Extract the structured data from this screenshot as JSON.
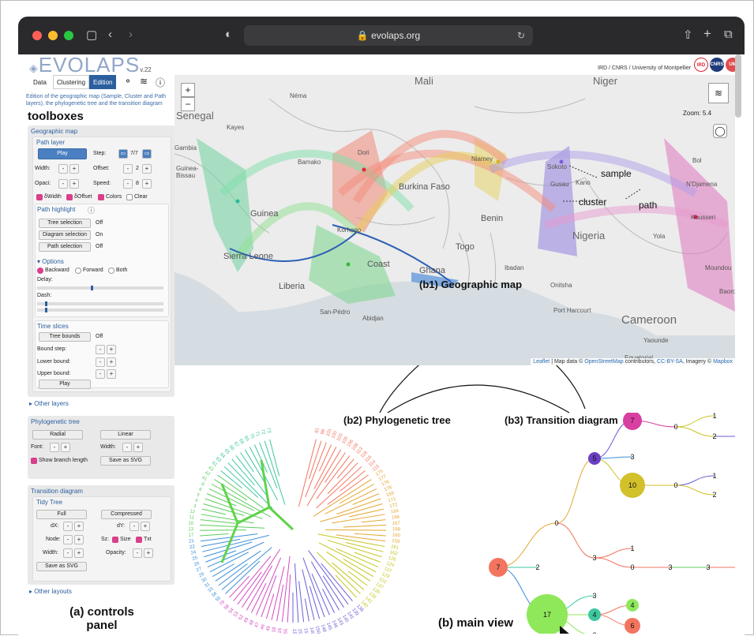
{
  "browser": {
    "url": "evolaps.org"
  },
  "header": {
    "logo": "EVOLAPS",
    "version": "v.22",
    "credit": "IRD / CNRS / University of Montpellier",
    "badges": [
      "IRD",
      "CNRS",
      "UM"
    ]
  },
  "tabs": [
    {
      "label": "Data"
    },
    {
      "label": "Clustering"
    },
    {
      "label": "Edition"
    }
  ],
  "description": "Edition of the geographic map (Sample, Cluster and Path layers), the phylogenetic tree and the transition diagram",
  "callouts": {
    "toolboxes": "toolboxes",
    "controls_panel_line1": "(a) controls",
    "controls_panel_line2": "panel",
    "main_view": "(b) main view",
    "b1": "(b1) Geographic map",
    "b2": "(b2) Phylogenetic tree",
    "b3": "(b3) Transition diagram",
    "sample": "sample",
    "cluster": "cluster",
    "path": "path"
  },
  "geomap": {
    "title": "Geographic map",
    "path_layer": {
      "title": "Path layer",
      "play": "Play",
      "step_label": "Step:",
      "step_value": "7/7",
      "width_label": "Width:",
      "offset_label": "Offset:",
      "offset_value": "2",
      "opaci_label": "Opaci:",
      "speed_label": "Speed:",
      "speed_value": "8",
      "checks": [
        "δWidth",
        "δOffset",
        "Colors",
        "Clear"
      ]
    },
    "highlight": {
      "title": "Path highlight",
      "rows": [
        {
          "button": "Tree selection",
          "state": "Off"
        },
        {
          "button": "Diagram selection",
          "state": "On"
        },
        {
          "button": "Path selection",
          "state": "Off"
        }
      ],
      "options": "Options",
      "radios": [
        "Backward",
        "Forward",
        "Both"
      ],
      "delay": "Delay:",
      "dash": "Dash:"
    },
    "time_slices": {
      "title": "Time slices",
      "tree_bounds": "Tree bounds",
      "tree_bounds_state": "Off",
      "bound_step": "Bound step:",
      "lower": "Lower bound:",
      "upper": "Upper bound:",
      "play": "Play"
    },
    "other_layers": "Other layers"
  },
  "phylo": {
    "title": "Phylogenetic tree",
    "radial": "Radial",
    "linear": "Linear",
    "font": "Font:",
    "width": "Width:",
    "show_branch": "Show branch length",
    "save": "Save as SVG"
  },
  "transition": {
    "title": "Transition diagram",
    "tidy": "Tidy Tree",
    "full": "Full",
    "compressed": "Compressed",
    "dx": "dX:",
    "dy": "dY:",
    "node": "Node:",
    "sz": "Sz:",
    "size": "Size",
    "txt": "Txt",
    "width": "Width:",
    "opacity": "Opacity:",
    "save": "Save as SVG",
    "other_layouts": "Other layouts"
  },
  "map": {
    "zoom_text": "Zoom: 5.4",
    "places": [
      "Mali",
      "Niger",
      "Néma",
      "Senegal",
      "Kayes",
      "Gambia",
      "Guinea-Bissau",
      "Bamako",
      "Dori",
      "Niamey",
      "Sokoto",
      "Kano",
      "Burkina Faso",
      "Guinea",
      "Korhogo",
      "N'Djamena",
      "Bol",
      "Gusau",
      "Sierra Leone",
      "Liberia",
      "Coast",
      "Togo",
      "Benin",
      "Nigeria",
      "Yola",
      "Ghana",
      "Ibadan",
      "Onitsha",
      "San-Pédro",
      "Abidjan",
      "Port Harcourt",
      "Cameroon",
      "Yaounde",
      "Equatorial",
      "Baoro",
      "Moundou",
      "Kousseri"
    ],
    "attribution": {
      "leaflet": "Leaflet",
      "map_data": " | Map data © ",
      "osm": "OpenStreetMap",
      "contrib": " contributors, ",
      "cc": "CC-BY-SA",
      "imagery": ", Imagery © ",
      "mapbox": "Mapbox"
    }
  },
  "tree": {
    "tip_labels": [
      "81",
      "99",
      "101",
      "100",
      "103",
      "105",
      "106",
      "108",
      "113",
      "118",
      "116",
      "114",
      "115",
      "175",
      "177",
      "176",
      "178",
      "169",
      "171",
      "172",
      "164",
      "166",
      "167",
      "168",
      "160",
      "159",
      "161",
      "162",
      "126",
      "124",
      "127",
      "129",
      "122",
      "137",
      "135",
      "136",
      "141",
      "140",
      "138",
      "139",
      "141",
      "145",
      "143",
      "146",
      "145",
      "148",
      "150",
      "149",
      "151",
      "153",
      "154",
      "155",
      "16",
      "18",
      "45",
      "46",
      "47",
      "48",
      "49",
      "52",
      "53",
      "54",
      "58",
      "79",
      "55",
      "34",
      "33",
      "31",
      "30",
      "29",
      "27",
      "26",
      "25",
      "24",
      "22",
      "21",
      "17",
      "13",
      "10",
      "11",
      "12",
      "3",
      "4",
      "5",
      "6",
      "8",
      "41",
      "42",
      "43",
      "61",
      "63",
      "64",
      "65",
      "66",
      "67",
      "68",
      "69",
      "70",
      "71",
      "72",
      "73"
    ]
  },
  "diagram": {
    "nodes": [
      {
        "label": "7"
      },
      {
        "label": "0"
      },
      {
        "label": "1"
      },
      {
        "label": "2"
      },
      {
        "label": "1"
      },
      {
        "label": "5"
      },
      {
        "label": "3"
      },
      {
        "label": "10"
      },
      {
        "label": "0"
      },
      {
        "label": "1"
      },
      {
        "label": "2"
      },
      {
        "label": "0"
      },
      {
        "label": "7"
      },
      {
        "label": "2"
      },
      {
        "label": "3"
      },
      {
        "label": "1"
      },
      {
        "label": "0"
      },
      {
        "label": "3"
      },
      {
        "label": "3"
      },
      {
        "label": "3"
      },
      {
        "label": "17"
      },
      {
        "label": "3"
      },
      {
        "label": "4"
      },
      {
        "label": "4"
      },
      {
        "label": "6"
      },
      {
        "label": "2"
      }
    ]
  },
  "colors": {
    "accent": "#2b5f9e",
    "pink": "#d93f8a"
  }
}
